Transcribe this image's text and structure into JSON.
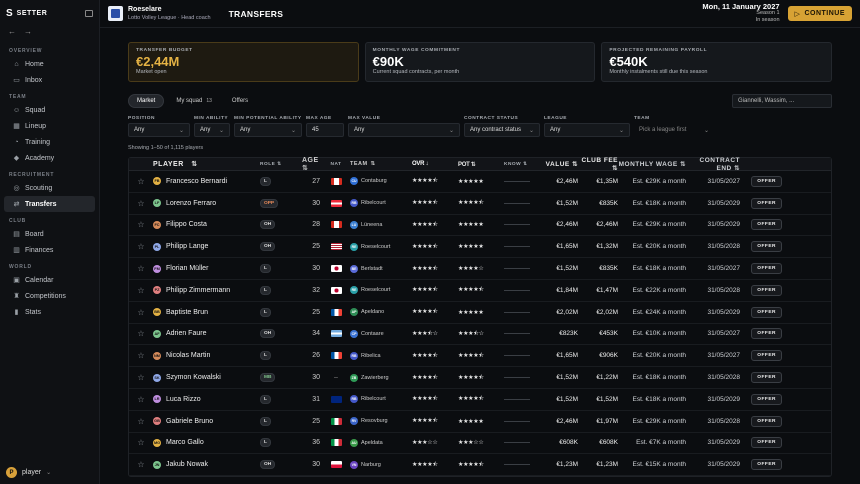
{
  "brand": {
    "logo": "S",
    "name": "SETTER"
  },
  "sidebar": {
    "sections": [
      {
        "title": "OVERVIEW",
        "items": [
          {
            "label": "Home",
            "icon": "home-icon"
          },
          {
            "label": "Inbox",
            "icon": "inbox-icon"
          }
        ]
      },
      {
        "title": "TEAM",
        "items": [
          {
            "label": "Squad",
            "icon": "users-icon"
          },
          {
            "label": "Lineup",
            "icon": "lineup-icon"
          },
          {
            "label": "Training",
            "icon": "training-icon"
          },
          {
            "label": "Academy",
            "icon": "academy-icon"
          }
        ]
      },
      {
        "title": "RECRUITMENT",
        "items": [
          {
            "label": "Scouting",
            "icon": "scouting-icon"
          },
          {
            "label": "Transfers",
            "icon": "transfers-icon"
          }
        ]
      },
      {
        "title": "CLUB",
        "items": [
          {
            "label": "Board",
            "icon": "board-icon"
          },
          {
            "label": "Finances",
            "icon": "finances-icon"
          }
        ]
      },
      {
        "title": "WORLD",
        "items": [
          {
            "label": "Calendar",
            "icon": "calendar-icon"
          },
          {
            "label": "Competitions",
            "icon": "trophy-icon"
          },
          {
            "label": "Stats",
            "icon": "stats-icon"
          }
        ]
      }
    ],
    "active": "Transfers",
    "user": {
      "initial": "P",
      "name": "player"
    }
  },
  "topbar": {
    "club": "Roeselare",
    "club_sub": "Lotto Volley League · Head coach",
    "title": "TRANSFERS",
    "date": "Mon, 11 January 2027",
    "season": "Season 1",
    "phase": "In season",
    "continue": "CONTINUE"
  },
  "cards": [
    {
      "label": "TRANSFER BUDGET",
      "value": "€2,44M",
      "sub": "Market open"
    },
    {
      "label": "MONTHLY WAGE COMMITMENT",
      "value": "€90K",
      "sub": "Current squad contracts, per month"
    },
    {
      "label": "PROJECTED REMAINING PAYROLL",
      "value": "€540K",
      "sub": "Monthly instalments still due this season"
    }
  ],
  "tabs": [
    {
      "label": "Market",
      "count": ""
    },
    {
      "label": "My squad",
      "count": "13"
    },
    {
      "label": "Offers",
      "count": ""
    }
  ],
  "search": {
    "placeholder": "Giannelli, Wassim, ..."
  },
  "filters": [
    {
      "label": "POSITION",
      "value": "Any"
    },
    {
      "label": "MIN ABILITY",
      "value": "Any"
    },
    {
      "label": "MIN POTENTIAL ABILITY",
      "value": "Any"
    },
    {
      "label": "MAX AGE",
      "value": "45"
    },
    {
      "label": "MAX VALUE",
      "value": "Any"
    },
    {
      "label": "CONTRACT STATUS",
      "value": "Any contract status"
    },
    {
      "label": "LEAGUE",
      "value": "Any"
    },
    {
      "label": "TEAM",
      "value": "Pick a league first"
    }
  ],
  "showing": "Showing 1–50 of 1,115 players",
  "columns": {
    "player": "PLAYER",
    "role": "ROLE",
    "age": "AGE",
    "nat": "NAT",
    "team": "TEAM",
    "ovr": "OVR",
    "pot": "POT",
    "know": "KNOW",
    "value": "VALUE",
    "fee": "CLUB FEE",
    "wage": "MONTHLY WAGE",
    "end": "CONTRACT END"
  },
  "offer_label": "OFFER",
  "rows": [
    {
      "initials": "FB",
      "name": "Francesco Bernardi",
      "role": "L",
      "age": "27",
      "nat": "CA",
      "team_abbr": "CU",
      "team": "Contaburg",
      "ovr": "★★★★⯪",
      "pot": "★★★★★",
      "value": "€2,46M",
      "fee": "€1,35M",
      "wage": "Est. €29K a month",
      "end": "31/05/2027"
    },
    {
      "initials": "LF",
      "name": "Lorenzo Ferraro",
      "role": "OPP",
      "age": "30",
      "nat": "AT",
      "team_abbr": "RB",
      "team": "Ribelcourt",
      "ovr": "★★★★⯪",
      "pot": "★★★★⯪",
      "value": "€1,52M",
      "fee": "€835K",
      "wage": "Est. €18K a month",
      "end": "31/05/2029"
    },
    {
      "initials": "FC",
      "name": "Filippo Costa",
      "role": "OH",
      "age": "28",
      "nat": "CA",
      "team_abbr": "LU",
      "team": "Lüneena",
      "ovr": "★★★★⯪",
      "pot": "★★★★★",
      "value": "€2,46M",
      "fee": "€2,46M",
      "wage": "Est. €29K a month",
      "end": "31/05/2029"
    },
    {
      "initials": "PL",
      "name": "Philipp Lange",
      "role": "OH",
      "age": "25",
      "nat": "US",
      "team_abbr": "RE",
      "team": "Roeselcourt",
      "ovr": "★★★★⯪",
      "pot": "★★★★★",
      "value": "€1,65M",
      "fee": "€1,32M",
      "wage": "Est. €20K a month",
      "end": "31/05/2028"
    },
    {
      "initials": "FM",
      "name": "Florian Müller",
      "role": "L",
      "age": "30",
      "nat": "JP",
      "team_abbr": "BE",
      "team": "Berlstadt",
      "ovr": "★★★★⯪",
      "pot": "★★★★☆",
      "value": "€1,52M",
      "fee": "€835K",
      "wage": "Est. €18K a month",
      "end": "31/05/2027"
    },
    {
      "initials": "PZ",
      "name": "Philipp Zimmermann",
      "role": "L",
      "age": "32",
      "nat": "JP",
      "team_abbr": "RE",
      "team": "Roeselcourt",
      "ovr": "★★★★⯪",
      "pot": "★★★★⯪",
      "value": "€1,84M",
      "fee": "€1,47M",
      "wage": "Est. €22K a month",
      "end": "31/05/2028"
    },
    {
      "initials": "BB",
      "name": "Baptiste Brun",
      "role": "L",
      "age": "25",
      "nat": "FR",
      "team_abbr": "AP",
      "team": "Apeldano",
      "ovr": "★★★★⯪",
      "pot": "★★★★★",
      "value": "€2,02M",
      "fee": "€2,02M",
      "wage": "Est. €24K a month",
      "end": "31/05/2029"
    },
    {
      "initials": "AF",
      "name": "Adrien Faure",
      "role": "OH",
      "age": "34",
      "nat": "AR",
      "team_abbr": "CP",
      "team": "Contaare",
      "ovr": "★★★⯪☆",
      "pot": "★★★⯪☆",
      "value": "€823K",
      "fee": "€453K",
      "wage": "Est. €10K a month",
      "end": "31/05/2027"
    },
    {
      "initials": "NM",
      "name": "Nicolas Martin",
      "role": "L",
      "age": "26",
      "nat": "FR",
      "team_abbr": "RB",
      "team": "Ribelica",
      "ovr": "★★★★⯪",
      "pot": "★★★★⯪",
      "value": "€1,65M",
      "fee": "€906K",
      "wage": "Est. €20K a month",
      "end": "31/05/2027"
    },
    {
      "initials": "SK",
      "name": "Szymon Kowalski",
      "role": "MB",
      "age": "30",
      "nat": "",
      "team_abbr": "ZB",
      "team": "Zawierberg",
      "ovr": "★★★★⯪",
      "pot": "★★★★⯪",
      "value": "€1,52M",
      "fee": "€1,22M",
      "wage": "Est. €18K a month",
      "end": "31/05/2028"
    },
    {
      "initials": "LR",
      "name": "Luca Rizzo",
      "role": "L",
      "age": "31",
      "nat": "AU",
      "team_abbr": "RB",
      "team": "Ribelcourt",
      "ovr": "★★★★⯪",
      "pot": "★★★★⯪",
      "value": "€1,52M",
      "fee": "€1,52M",
      "wage": "Est. €18K a month",
      "end": "31/05/2029"
    },
    {
      "initials": "GB",
      "name": "Gabriele Bruno",
      "role": "L",
      "age": "25",
      "nat": "IT",
      "team_abbr": "RV",
      "team": "Resovburg",
      "ovr": "★★★★⯪",
      "pot": "★★★★★",
      "value": "€2,46M",
      "fee": "€1,97M",
      "wage": "Est. €29K a month",
      "end": "31/05/2028"
    },
    {
      "initials": "MG",
      "name": "Marco Gallo",
      "role": "L",
      "age": "36",
      "nat": "IT",
      "team_abbr": "AU",
      "team": "Apeldata",
      "ovr": "★★★☆☆",
      "pot": "★★★☆☆",
      "value": "€608K",
      "fee": "€608K",
      "wage": "Est. €7K a month",
      "end": "31/05/2029"
    },
    {
      "initials": "JN",
      "name": "Jakub Nowak",
      "role": "OH",
      "age": "30",
      "nat": "PL",
      "team_abbr": "VN",
      "team": "Narburg",
      "ovr": "★★★★⯪",
      "pot": "★★★★⯪",
      "value": "€1,23M",
      "fee": "€1,23M",
      "wage": "Est. €15K a month",
      "end": "31/05/2029"
    }
  ],
  "colors": {
    "accent": "#d7a234",
    "bg": "#0b0d10",
    "sidebar": "#0f1114"
  }
}
